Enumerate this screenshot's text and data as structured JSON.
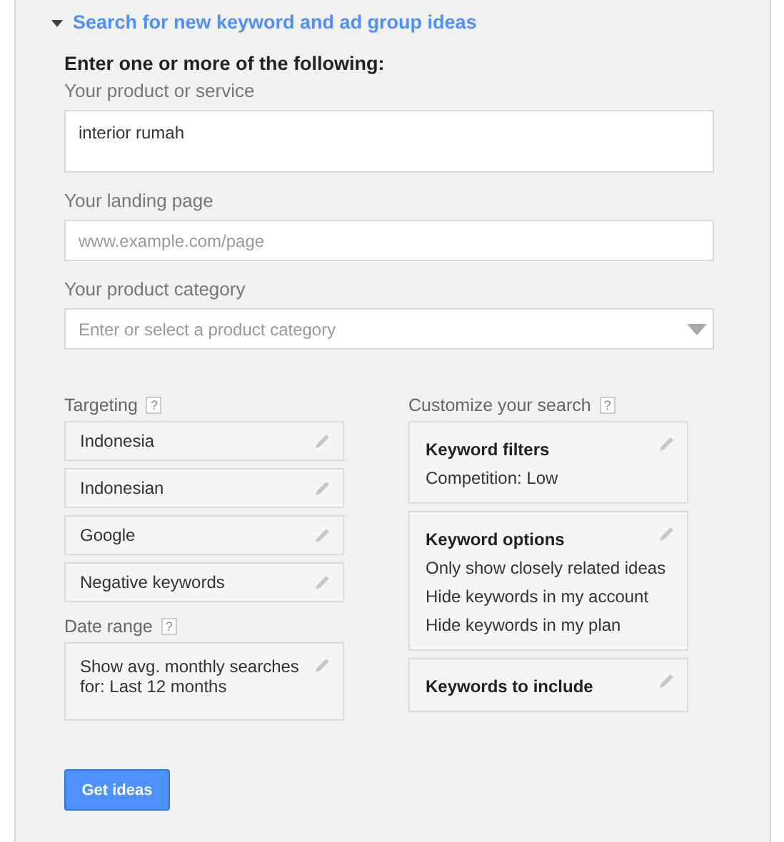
{
  "section": {
    "title": "Search for new keyword and ad group ideas",
    "expanded": true
  },
  "intro": "Enter one or more of the following:",
  "fields": [
    {
      "kind": "textarea",
      "label": "Your product or service",
      "value": "interior rumah"
    },
    {
      "kind": "input",
      "label": "Your landing page",
      "placeholder": "www.example.com/page"
    },
    {
      "kind": "select",
      "label": "Your product category",
      "placeholder": "Enter or select a product category"
    }
  ],
  "help_mark": "?",
  "targeting": {
    "label": "Targeting",
    "items": [
      "Indonesia",
      "Indonesian",
      "Google",
      "Negative keywords"
    ]
  },
  "date_range": {
    "label": "Date range",
    "text": "Show avg. monthly searches for: Last 12 months"
  },
  "customize": {
    "label": "Customize your search",
    "cards": [
      {
        "title": "Keyword filters",
        "lines": [
          "Competition: Low"
        ]
      },
      {
        "title": "Keyword options",
        "lines": [
          "Only show closely related ideas",
          "Hide keywords in my account",
          "Hide keywords in my plan"
        ]
      },
      {
        "title": "Keywords to include"
      }
    ]
  },
  "button": "Get ideas"
}
